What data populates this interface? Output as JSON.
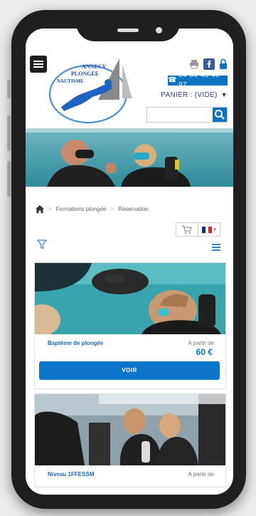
{
  "header": {
    "logo_lines": [
      "ANNECY",
      "PLONGEE",
      "NAUTISME"
    ],
    "phone_number": "04 50 45 40 97",
    "cart_label": "PANIER : (VIDE)",
    "search_placeholder": ""
  },
  "breadcrumb": {
    "items": [
      "Formations plongée",
      "Réservation"
    ],
    "separator": ">"
  },
  "cards": [
    {
      "title": "Baptême de plongée",
      "from_label": "A partir de",
      "price": "60 €",
      "button_label": "VOIR"
    },
    {
      "title": "Niveau 1FFESSM",
      "from_label": "A partir de"
    }
  ],
  "colors": {
    "accent": "#0b74c0",
    "title_blue": "#1f66b0",
    "cart_blue": "#2c3e8c"
  }
}
